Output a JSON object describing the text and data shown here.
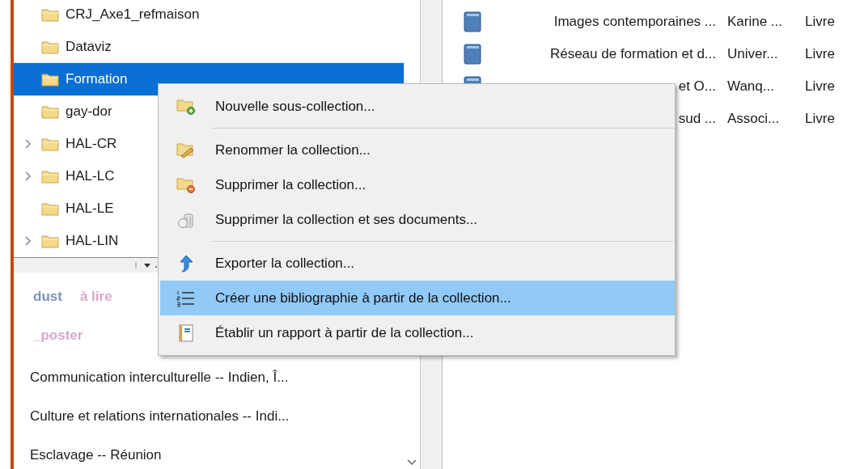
{
  "collections": [
    {
      "label": "CRJ_Axe1_refmaison",
      "expandable": false,
      "selected": false
    },
    {
      "label": "Dataviz",
      "expandable": false,
      "selected": false
    },
    {
      "label": "Formation",
      "expandable": false,
      "selected": true
    },
    {
      "label": "gay-dor",
      "expandable": false,
      "selected": false
    },
    {
      "label": "HAL-CR",
      "expandable": true,
      "selected": false
    },
    {
      "label": "HAL-LC",
      "expandable": true,
      "selected": false
    },
    {
      "label": "HAL-LE",
      "expandable": false,
      "selected": false
    },
    {
      "label": "HAL-LIN",
      "expandable": true,
      "selected": false
    }
  ],
  "tags": [
    {
      "label": "dust",
      "color": "#7f93b5"
    },
    {
      "label": "à lire",
      "color": "#d7a9cc"
    },
    {
      "label": "_poster",
      "color": "#d7a9cc"
    }
  ],
  "subjects": [
    "Communication interculturelle -- Indien, Î...",
    "Culture et relations internationales -- Indi...",
    "Esclavage -- Réunion"
  ],
  "items": [
    {
      "title": "Images contemporaines ...",
      "creator": "Karine ...",
      "type": "Livre"
    },
    {
      "title": "Réseau de formation et d...",
      "creator": "Univer...",
      "type": "Livre"
    },
    {
      "title": "et O...",
      "creator": "Wanq...",
      "type": "Livre"
    },
    {
      "title": "sud ...",
      "creator": "Associ...",
      "type": "Livre"
    }
  ],
  "context_menu": [
    {
      "kind": "new",
      "label": "Nouvelle sous-collection...",
      "selected": false
    },
    {
      "kind": "separator"
    },
    {
      "kind": "rename",
      "label": "Renommer la collection...",
      "selected": false
    },
    {
      "kind": "delete",
      "label": "Supprimer la collection...",
      "selected": false
    },
    {
      "kind": "delete-all",
      "label": "Supprimer la collection et ses documents...",
      "selected": false
    },
    {
      "kind": "separator"
    },
    {
      "kind": "export",
      "label": "Exporter la collection...",
      "selected": false
    },
    {
      "kind": "bibliography",
      "label": "Créer une bibliographie à partir de la collection...",
      "selected": true
    },
    {
      "kind": "report",
      "label": "Établir un rapport à partir de la collection...",
      "selected": false
    }
  ]
}
